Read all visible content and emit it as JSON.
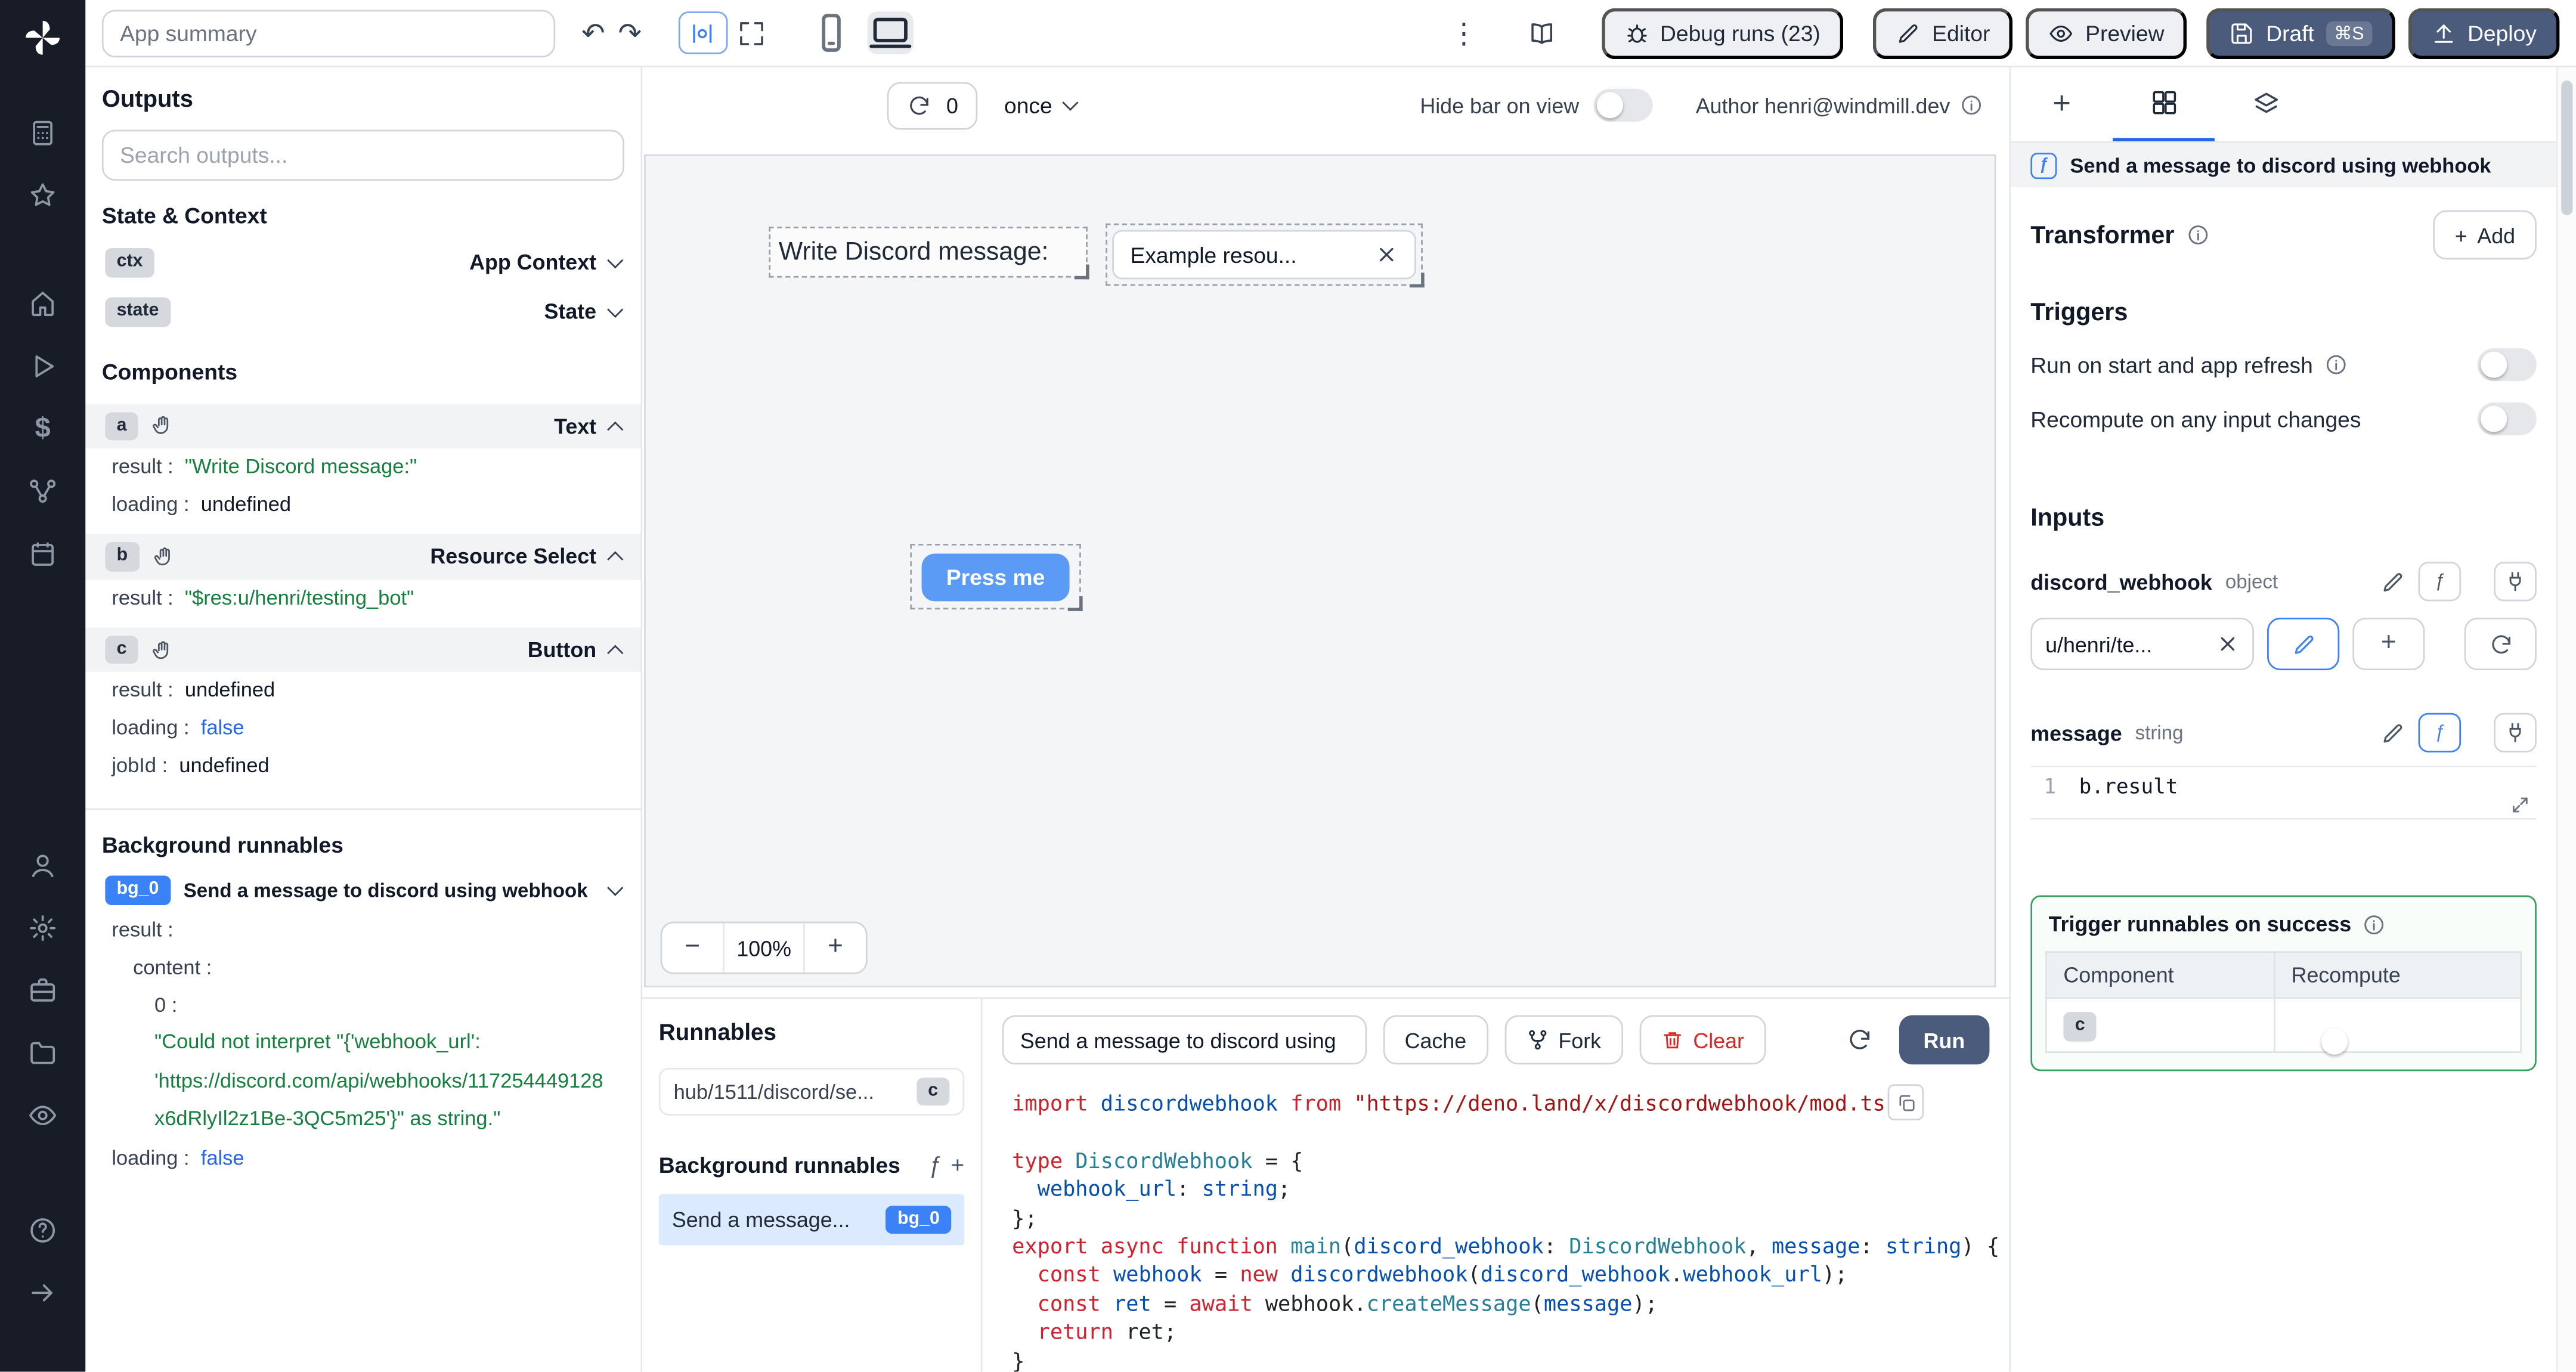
{
  "glyphs": {
    "undo": "↶",
    "redo": "↷",
    "kebab": "⋮",
    "dollar": "$",
    "fx": "ƒ",
    "plus": "+",
    "minus": "−"
  },
  "topbar": {
    "app_summary": "App summary",
    "debug_runs": "Debug runs (23)",
    "editor": "Editor",
    "preview": "Preview",
    "draft": "Draft",
    "draft_kbd": "⌘S",
    "deploy": "Deploy"
  },
  "canvas_toolbar": {
    "count": "0",
    "mode": "once",
    "hide_bar": "Hide bar on view",
    "author": "Author henri@windmill.dev"
  },
  "canvas": {
    "text": "Write Discord message:",
    "select_value": "Example resou...",
    "button": "Press me",
    "zoom": "100%"
  },
  "outputs": {
    "title": "Outputs",
    "search_placeholder": "Search outputs...",
    "state_context": {
      "title": "State & Context",
      "ctx_badge": "ctx",
      "ctx_label": "App Context",
      "state_badge": "state",
      "state_label": "State"
    },
    "components": {
      "title": "Components",
      "a": {
        "badge": "a",
        "type": "Text",
        "k1": "result",
        "v1": "\"Write Discord message:\"",
        "k2": "loading",
        "v2": "undefined"
      },
      "b": {
        "badge": "b",
        "type": "Resource Select",
        "k1": "result",
        "v1": "\"$res:u/henri/testing_bot\""
      },
      "c": {
        "badge": "c",
        "type": "Button",
        "k1": "result",
        "v1": "undefined",
        "k2": "loading",
        "v2": "false",
        "k3": "jobId",
        "v3": "undefined"
      }
    },
    "background": {
      "title": "Background runnables",
      "badge": "bg_0",
      "name": "Send a message to discord using webhook",
      "result_key": "result",
      "content_key": "content",
      "index_key": "0",
      "error_line1": "\"Could not interpret \"{'webhook_url':",
      "error_line2": "'https://discord.com/api/webhooks/117254449128",
      "error_line3": "x6dRlyIl2z1Be-3QC5m25'}\" as string.\"",
      "loading_key": "loading",
      "loading_value": "false"
    }
  },
  "runnables": {
    "title": "Runnables",
    "main_item": "hub/1511/discord/se...",
    "main_item_badge": "c",
    "background_title": "Background runnables",
    "bg_item": "Send a message...",
    "bg_item_badge": "bg_0"
  },
  "editor": {
    "name": "Send a message to discord using",
    "cache": "Cache",
    "fork": "Fork",
    "clear": "Clear",
    "run": "Run",
    "code_lines": [
      [
        [
          "k",
          "import "
        ],
        [
          "v",
          "discordwebhook "
        ],
        [
          "k",
          "from "
        ],
        [
          "s",
          "\"https://deno.land/x/discordwebhook/mod.ts\""
        ],
        [
          "p",
          ";"
        ]
      ],
      [],
      [
        [
          "k",
          "type "
        ],
        [
          "t",
          "DiscordWebhook"
        ],
        [
          "p",
          " = {"
        ]
      ],
      [
        [
          "p",
          "  "
        ],
        [
          "v",
          "webhook_url"
        ],
        [
          "p",
          ": "
        ],
        [
          "v",
          "string"
        ],
        [
          "p",
          ";"
        ]
      ],
      [
        [
          "p",
          "};"
        ]
      ],
      [
        [
          "k",
          "export async function "
        ],
        [
          "t",
          "main"
        ],
        [
          "p",
          "("
        ],
        [
          "v",
          "discord_webhook"
        ],
        [
          "p",
          ": "
        ],
        [
          "t",
          "DiscordWebhook"
        ],
        [
          "p",
          ", "
        ],
        [
          "v",
          "message"
        ],
        [
          "p",
          ": "
        ],
        [
          "v",
          "string"
        ],
        [
          "p",
          ") {"
        ]
      ],
      [
        [
          "p",
          "  "
        ],
        [
          "k",
          "const "
        ],
        [
          "v",
          "webhook"
        ],
        [
          "p",
          " = "
        ],
        [
          "k",
          "new "
        ],
        [
          "v",
          "discordwebhook"
        ],
        [
          "p",
          "("
        ],
        [
          "v",
          "discord_webhook"
        ],
        [
          "p",
          "."
        ],
        [
          "v",
          "webhook_url"
        ],
        [
          "p",
          ");"
        ]
      ],
      [
        [
          "p",
          "  "
        ],
        [
          "k",
          "const "
        ],
        [
          "v",
          "ret"
        ],
        [
          "p",
          " = "
        ],
        [
          "k",
          "await "
        ],
        [
          "p",
          "webhook."
        ],
        [
          "t",
          "createMessage"
        ],
        [
          "p",
          "("
        ],
        [
          "v",
          "message"
        ],
        [
          "p",
          ");"
        ]
      ],
      [
        [
          "p",
          "  "
        ],
        [
          "k",
          "return "
        ],
        [
          "p",
          "ret;"
        ]
      ],
      [
        [
          "p",
          "}"
        ]
      ]
    ]
  },
  "right": {
    "header": "Send a message to discord using webhook",
    "transformer": "Transformer",
    "add": "Add",
    "triggers_title": "Triggers",
    "trigger1": "Run on start and app refresh",
    "trigger2": "Recompute on any input changes",
    "inputs_title": "Inputs",
    "input1_name": "discord_webhook",
    "input1_type": "object",
    "input1_value": "u/henri/te...",
    "input2_name": "message",
    "input2_type": "string",
    "input2_lineno": "1",
    "input2_code": "b.result",
    "success_title": "Trigger runnables on success",
    "success_col1": "Component",
    "success_col2": "Recompute",
    "success_badge": "c"
  }
}
